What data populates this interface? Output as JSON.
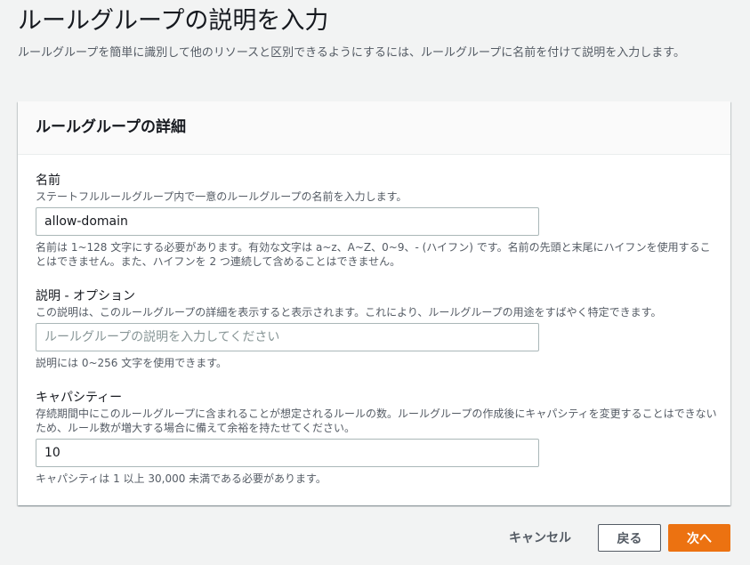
{
  "page": {
    "title": "ルールグループの説明を入力",
    "description": "ルールグループを簡単に識別して他のリソースと区別できるようにするには、ルールグループに名前を付けて説明を入力します。"
  },
  "panel": {
    "title": "ルールグループの詳細"
  },
  "fields": {
    "name": {
      "label": "名前",
      "description": "ステートフルルールグループ内で一意のルールグループの名前を入力します。",
      "value": "allow-domain",
      "constraint": "名前は 1~128 文字にする必要があります。有効な文字は a~z、A~Z、0~9、- (ハイフン) です。名前の先頭と末尾にハイフンを使用することはできません。また、ハイフンを 2 つ連続して含めることはできません。"
    },
    "description": {
      "label": "説明 - オプション",
      "description": "この説明は、このルールグループの詳細を表示すると表示されます。これにより、ルールグループの用途をすばやく特定できます。",
      "value": "",
      "placeholder": "ルールグループの説明を入力してください",
      "constraint": "説明には 0~256 文字を使用できます。"
    },
    "capacity": {
      "label": "キャパシティー",
      "description": "存続期間中にこのルールグループに含まれることが想定されるルールの数。ルールグループの作成後にキャパシティを変更することはできないため、ルール数が増大する場合に備えて余裕を持たせてください。",
      "value": "10",
      "constraint": "キャパシティは 1 以上 30,000 未満である必要があります。"
    }
  },
  "footer": {
    "cancel_label": "キャンセル",
    "back_label": "戻る",
    "next_label": "次へ"
  },
  "colors": {
    "primary": "#ec7211",
    "background": "#f2f3f3",
    "panel": "#ffffff",
    "text": "#16191f",
    "secondary_text": "#545b64"
  }
}
